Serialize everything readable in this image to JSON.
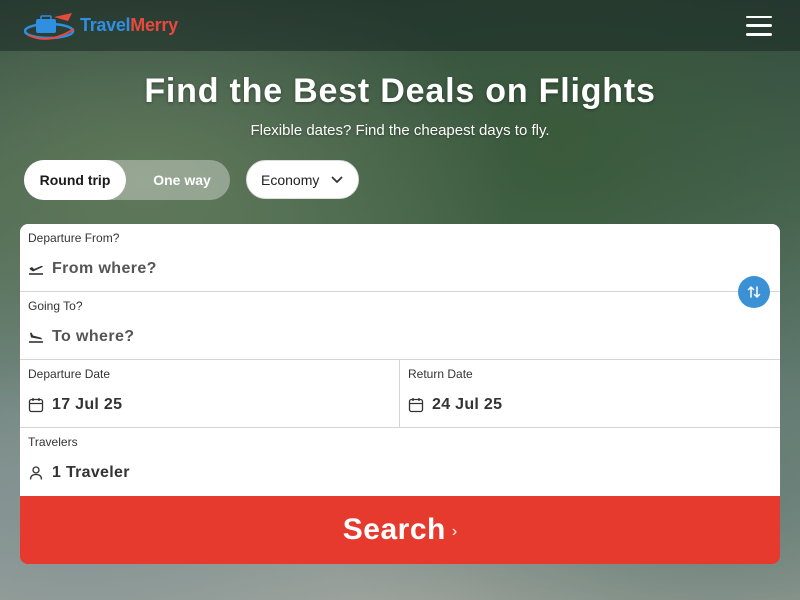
{
  "header": {
    "logo_part1": "Travel",
    "logo_part2": "Merry",
    "menu_icon": "hamburger-menu-icon"
  },
  "hero": {
    "title": "Find the Best Deals on Flights",
    "subtitle": "Flexible dates? Find the cheapest days to fly."
  },
  "trip_type": {
    "options": [
      "Round trip",
      "One way"
    ],
    "selected": "Round trip"
  },
  "cabin": {
    "selected": "Economy",
    "icon": "chevron-down-icon"
  },
  "form": {
    "from": {
      "label": "Departure From?",
      "placeholder": "From where?",
      "icon": "plane-takeoff-icon"
    },
    "to": {
      "label": "Going To?",
      "placeholder": "To where?",
      "icon": "plane-landing-icon"
    },
    "swap_icon": "swap-icon",
    "departure_date": {
      "label": "Departure Date",
      "value": "17 Jul 25",
      "icon": "calendar-icon"
    },
    "return_date": {
      "label": "Return Date",
      "value": "24 Jul 25",
      "icon": "calendar-icon"
    },
    "travelers": {
      "label": "Travelers",
      "value": "1 Traveler",
      "icon": "user-icon"
    }
  },
  "search": {
    "label": "Search",
    "arrow": "›"
  },
  "colors": {
    "brand_blue": "#2f8fe0",
    "brand_red": "#e8493e",
    "search_red": "#e63a2e",
    "swap_blue": "#3a91d6"
  }
}
